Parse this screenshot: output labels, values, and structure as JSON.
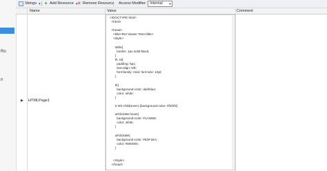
{
  "left_panel": {
    "label_a": "Ro",
    "label_b": "n"
  },
  "toolbar": {
    "strings_label": "Strings",
    "add_resource_label": "Add Resource",
    "remove_resource_label": "Remove Resource",
    "access_modifier_label": "Access Modifier:",
    "access_modifier_value": "Internal"
  },
  "grid": {
    "columns": [
      "Name",
      "Value",
      "Comment"
    ],
    "row": {
      "name": "HTMLPage1",
      "value_lines": [
        "<!DOCTYPE html>",
        "<html>",
        "",
        "<head>",
        "<title>Rot Viewer Test</title>",
        "<style>",
        "",
        "table{",
        "border: 1px solid black;",
        "}",
        "th, td{",
        "padding: 5px;",
        "text-align: left;",
        "font-family: Arial; font-size: 10pt;",
        "}",
        "",
        "th{",
        "background-color: darkblue;",
        "color: white;",
        "}",
        "",
        "tr:nth-child(even) {background-color: #f2f2f2}",
        "",
        "a#clickMe:hover{",
        "background-color: #1A3658;",
        "color: white;",
        "}",
        "",
        "a#clickMe{",
        "background-color: #E0F1EA;",
        "color: #000000;",
        "}",
        "",
        "",
        "</style>",
        "</head>"
      ]
    }
  }
}
